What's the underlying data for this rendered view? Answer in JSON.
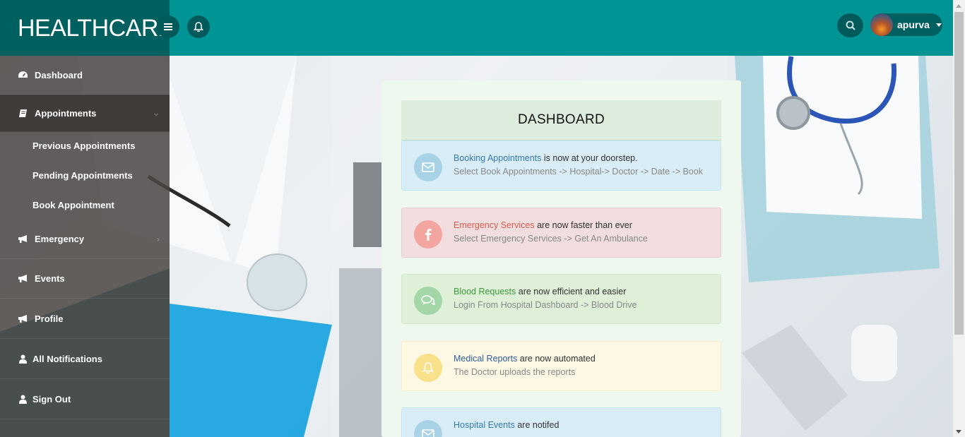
{
  "brand": "HEALTHCARE",
  "user": {
    "name": "apurva"
  },
  "sidebar": {
    "items": [
      {
        "label": "Dashboard"
      },
      {
        "label": "Appointments"
      },
      {
        "label": "Emergency"
      },
      {
        "label": "Events"
      },
      {
        "label": "Profile"
      },
      {
        "label": "All Notifications"
      },
      {
        "label": "Sign Out"
      }
    ],
    "sub_items": [
      {
        "label": "Previous Appointments"
      },
      {
        "label": "Pending Appointments"
      },
      {
        "label": "Book Appointment"
      }
    ]
  },
  "main": {
    "title": "DASHBOARD",
    "alerts": [
      {
        "highlight": "Booking Appointments",
        "rest": " is now at your doorstep.",
        "detail": "Select Book Appointments -> Hospital-> Doctor -> Date -> Book",
        "icon": "envelope-icon",
        "highlight_color": "#337ab7",
        "icon_bg": "#a8d3e6"
      },
      {
        "highlight": "Emergency Services",
        "rest": " are now faster than ever",
        "detail": "Select Emergency Services -> Get An Ambulance",
        "icon": "facebook-icon",
        "highlight_color": "#e05a4e",
        "icon_bg": "#f3a5a0"
      },
      {
        "highlight": "Blood Requests",
        "rest": " are now efficient and easier",
        "detail": "Login From Hospital Dashboard -> Blood Drive",
        "icon": "comments-icon",
        "highlight_color": "#3c9a3c",
        "icon_bg": "#a3d6a8"
      },
      {
        "highlight": "Medical Reports",
        "rest": " are now automated",
        "detail": "The Doctor uploads the reports",
        "icon": "bell-icon",
        "highlight_color": "#2f5f9e",
        "icon_bg": "#f9e08a"
      },
      {
        "highlight": "Hospital Events",
        "rest": " are notifed",
        "detail": "",
        "icon": "envelope-icon",
        "highlight_color": "#337ab7",
        "icon_bg": "#a8d3e6"
      }
    ]
  }
}
